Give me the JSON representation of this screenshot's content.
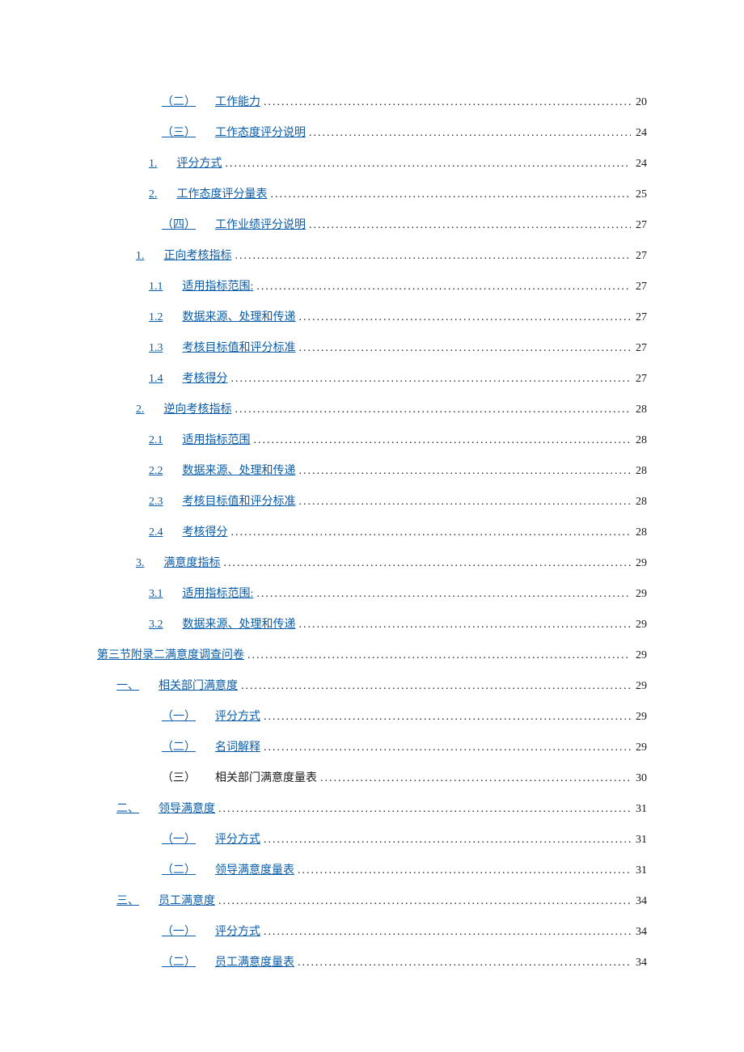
{
  "toc": [
    {
      "indent": 4,
      "number": "（二）",
      "title": "工作能力",
      "page": "20",
      "linked": true
    },
    {
      "indent": 4,
      "number": "（三）",
      "title": "工作态度评分说明",
      "page": "24",
      "linked": true
    },
    {
      "indent": 3,
      "number": "1.",
      "title": "评分方式",
      "page": "24",
      "linked": true
    },
    {
      "indent": 3,
      "number": "2.",
      "title": "工作态度评分量表",
      "page": "25",
      "linked": true
    },
    {
      "indent": 4,
      "number": "（四）",
      "title": "工作业绩评分说明",
      "page": "27",
      "linked": true
    },
    {
      "indent": 2,
      "number": "1.",
      "title": "正向考核指标",
      "page": "27",
      "linked": true
    },
    {
      "indent": 3,
      "number": "1.1",
      "title": "适用指标范围:",
      "page": "27",
      "linked": true
    },
    {
      "indent": 3,
      "number": "1.2",
      "title": "数据来源、处理和传递",
      "page": "27",
      "linked": true
    },
    {
      "indent": 3,
      "number": "1.3",
      "title": "考核目标值和评分标准",
      "page": "27",
      "linked": true
    },
    {
      "indent": 3,
      "number": "1.4",
      "title": "考核得分",
      "page": "27",
      "linked": true
    },
    {
      "indent": 2,
      "number": "2.",
      "title": "逆向考核指标",
      "page": "28",
      "linked": true
    },
    {
      "indent": 3,
      "number": "2.1",
      "title": "适用指标范围",
      "page": "28",
      "linked": true
    },
    {
      "indent": 3,
      "number": "2.2",
      "title": "数据来源、处理和传递",
      "page": "28",
      "linked": true
    },
    {
      "indent": 3,
      "number": "2.3",
      "title": "考核目标值和评分标准",
      "page": "28",
      "linked": true
    },
    {
      "indent": 3,
      "number": "2.4",
      "title": "考核得分",
      "page": "28",
      "linked": true
    },
    {
      "indent": 2,
      "number": "3.",
      "title": "满意度指标",
      "page": "29",
      "linked": true
    },
    {
      "indent": 3,
      "number": "3.1",
      "title": "适用指标范围:",
      "page": "29",
      "linked": true
    },
    {
      "indent": 3,
      "number": "3.2",
      "title": "数据来源、处理和传递",
      "page": "29",
      "linked": true
    },
    {
      "indent": 0,
      "number": "",
      "title": "第三节附录二满意度调查问卷",
      "page": "29",
      "linked": true
    },
    {
      "indent": 1,
      "number": "一、",
      "title": "相关部门满意度",
      "page": "29",
      "linked": true
    },
    {
      "indent": 4,
      "number": "（一）",
      "title": "评分方式",
      "page": "29",
      "linked": true
    },
    {
      "indent": 4,
      "number": "（二）",
      "title": "名词解释",
      "page": "29",
      "linked": true
    },
    {
      "indent": 4,
      "number": "（三）",
      "title": "相关部门满意度量表",
      "page": "30",
      "linked": false
    },
    {
      "indent": 1,
      "number": "二、",
      "title": "领导满意度",
      "page": "31",
      "linked": true
    },
    {
      "indent": 4,
      "number": "（一）",
      "title": "评分方式",
      "page": "31",
      "linked": true
    },
    {
      "indent": 4,
      "number": "（二）",
      "title": "领导满意度量表",
      "page": "31",
      "linked": true
    },
    {
      "indent": 1,
      "number": "三、",
      "title": "员工满意度",
      "page": "34",
      "linked": true
    },
    {
      "indent": 4,
      "number": "（一）",
      "title": "评分方式",
      "page": "34",
      "linked": true
    },
    {
      "indent": 4,
      "number": "（二）",
      "title": "员工满意度量表",
      "page": "34",
      "linked": true
    }
  ]
}
